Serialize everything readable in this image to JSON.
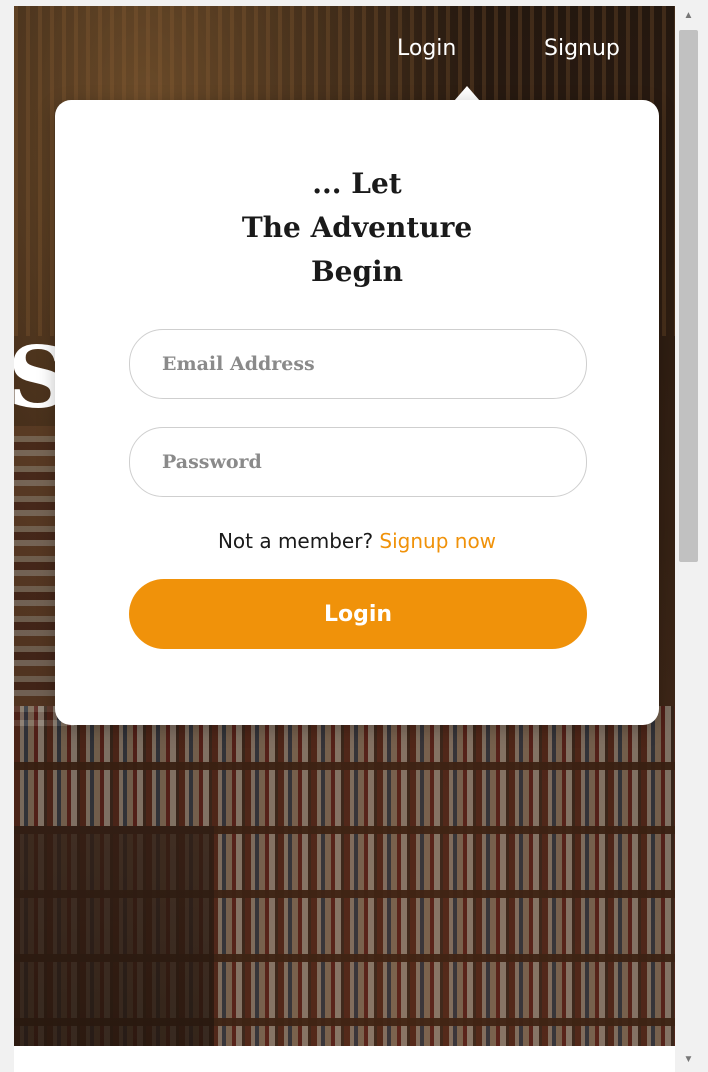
{
  "nav": {
    "login_label": "Login",
    "signup_label": "Signup"
  },
  "background": {
    "partial_letters": "S"
  },
  "popup": {
    "headline_line1": "... Let",
    "headline_line2": "The Adventure",
    "headline_line3": "Begin",
    "email_placeholder": "Email Address",
    "password_placeholder": "Password",
    "member_text": "Not a member?",
    "signup_link": "Signup now",
    "login_button": "Login"
  },
  "colors": {
    "accent": "#f0920a",
    "card": "#ffffff"
  },
  "icons": {
    "scroll_up": "triangle-up",
    "scroll_down": "triangle-down"
  }
}
